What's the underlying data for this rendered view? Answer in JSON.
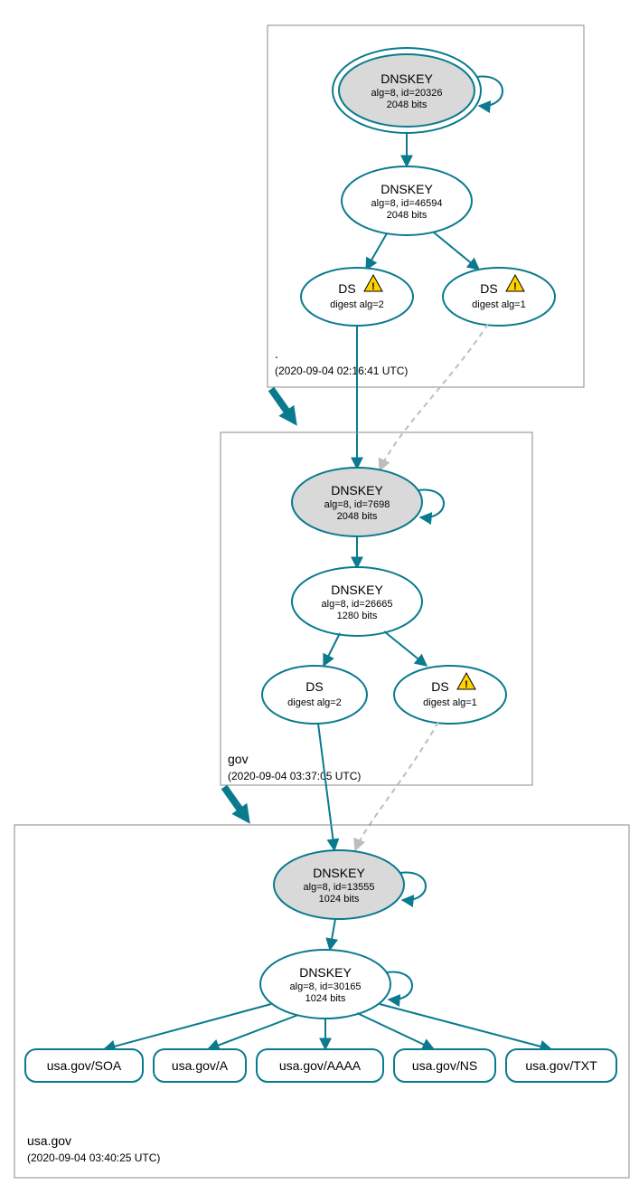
{
  "colors": {
    "accent": "#0a7a8f",
    "ksk_fill": "#d9d9d9",
    "dashed": "#bdbdbd",
    "warn": "#ffd200"
  },
  "zones": [
    {
      "name": ".",
      "timestamp": "(2020-09-04 02:16:41 UTC)",
      "nodes": {
        "ksk": {
          "title": "DNSKEY",
          "line2": "alg=8, id=20326",
          "line3": "2048 bits",
          "double_border": true,
          "self_loop": true
        },
        "zsk": {
          "title": "DNSKEY",
          "line2": "alg=8, id=46594",
          "line3": "2048 bits"
        },
        "ds_left": {
          "title": "DS",
          "sub": "digest alg=2",
          "warning": true
        },
        "ds_right": {
          "title": "DS",
          "sub": "digest alg=1",
          "warning": true
        }
      }
    },
    {
      "name": "gov",
      "timestamp": "(2020-09-04 03:37:05 UTC)",
      "nodes": {
        "ksk": {
          "title": "DNSKEY",
          "line2": "alg=8, id=7698",
          "line3": "2048 bits",
          "self_loop": true
        },
        "zsk": {
          "title": "DNSKEY",
          "line2": "alg=8, id=26665",
          "line3": "1280 bits"
        },
        "ds_left": {
          "title": "DS",
          "sub": "digest alg=2",
          "warning": false
        },
        "ds_right": {
          "title": "DS",
          "sub": "digest alg=1",
          "warning": true
        }
      }
    },
    {
      "name": "usa.gov",
      "timestamp": "(2020-09-04 03:40:25 UTC)",
      "nodes": {
        "ksk": {
          "title": "DNSKEY",
          "line2": "alg=8, id=13555",
          "line3": "1024 bits",
          "self_loop": true
        },
        "zsk": {
          "title": "DNSKEY",
          "line2": "alg=8, id=30165",
          "line3": "1024 bits",
          "self_loop": true
        }
      },
      "rrsets": [
        "usa.gov/SOA",
        "usa.gov/A",
        "usa.gov/AAAA",
        "usa.gov/NS",
        "usa.gov/TXT"
      ]
    }
  ]
}
